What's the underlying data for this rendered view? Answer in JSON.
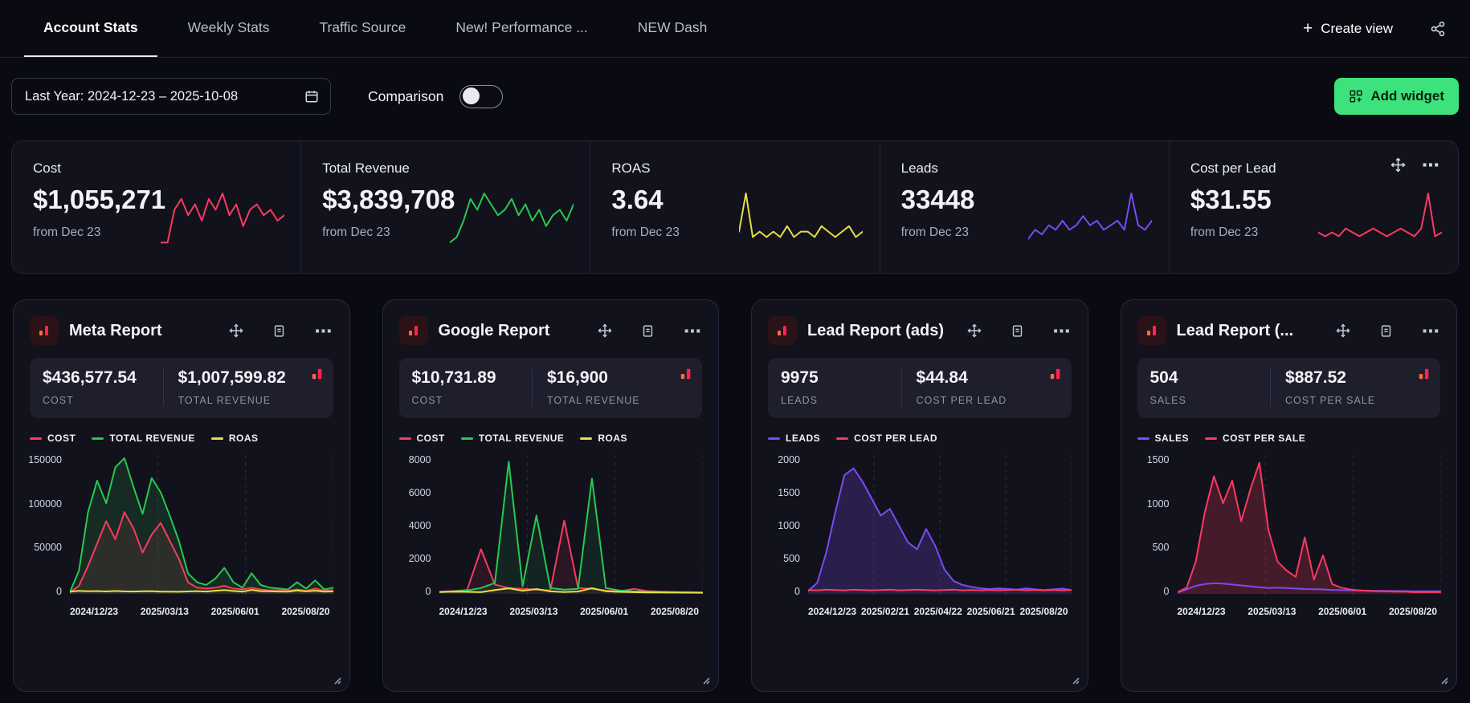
{
  "tabs": {
    "items": [
      {
        "label": "Account Stats",
        "active": true
      },
      {
        "label": "Weekly Stats",
        "active": false
      },
      {
        "label": "Traffic Source",
        "active": false
      },
      {
        "label": "New! Performance ...",
        "active": false
      },
      {
        "label": "NEW Dash",
        "active": false
      }
    ],
    "create_view_label": "Create view"
  },
  "icons": {
    "plus": "+",
    "ellipsis": "⋯"
  },
  "filters": {
    "date_range": "Last Year: 2024-12-23 – 2025-10-08",
    "comparison_label": "Comparison",
    "comparison_on": false,
    "add_widget_label": "Add widget",
    "add_widget_color": "#3ee27d"
  },
  "kpis": [
    {
      "label": "Cost",
      "value": "$1,055,271",
      "sub": "from Dec 23",
      "color": "#fb3a5e",
      "spark": [
        1,
        1,
        7,
        9,
        6,
        8,
        5,
        9,
        7,
        10,
        6,
        8,
        4,
        7,
        8,
        6,
        7,
        5,
        6
      ]
    },
    {
      "label": "Total Revenue",
      "value": "$3,839,708",
      "sub": "from Dec 23",
      "color": "#27c94f",
      "spark": [
        1,
        2,
        5,
        9,
        7,
        10,
        8,
        6,
        7,
        9,
        6,
        8,
        5,
        7,
        4,
        6,
        7,
        5,
        8
      ]
    },
    {
      "label": "ROAS",
      "value": "3.64",
      "sub": "from Dec 23",
      "color": "#e6df43",
      "spark": [
        3,
        10,
        2,
        3,
        2,
        3,
        2,
        4,
        2,
        3,
        3,
        2,
        4,
        3,
        2,
        3,
        4,
        2,
        3
      ]
    },
    {
      "label": "Leads",
      "value": "33448",
      "sub": "from Dec 23",
      "color": "#7a4bf5",
      "spark": [
        2,
        4,
        3,
        5,
        4,
        6,
        4,
        5,
        7,
        5,
        6,
        4,
        5,
        6,
        4,
        12,
        5,
        4,
        6
      ]
    },
    {
      "label": "Cost per Lead",
      "value": "$31.55",
      "sub": "from Dec 23",
      "color": "#fb3a5e",
      "spark": [
        4,
        3,
        4,
        3,
        5,
        4,
        3,
        4,
        5,
        4,
        3,
        4,
        5,
        4,
        3,
        5,
        14,
        3,
        4
      ]
    }
  ],
  "widgets": [
    {
      "title": "Meta Report",
      "stats": [
        {
          "value": "$436,577.54",
          "label": "COST"
        },
        {
          "value": "$1,007,599.82",
          "label": "TOTAL REVENUE"
        }
      ],
      "chart": {
        "type": "line",
        "y_ticks": [
          150000,
          100000,
          50000,
          0
        ],
        "y_max": 150000,
        "x_labels": [
          "2024/12/23",
          "2025/03/13",
          "2025/06/01",
          "2025/08/20"
        ],
        "series": [
          {
            "name": "COST",
            "color": "#fb3a5e",
            "fill": 0.12,
            "values": [
              500,
              8000,
              30000,
              55000,
              80000,
              60000,
              90000,
              72000,
              45000,
              65000,
              78000,
              58000,
              38000,
              12000,
              6000,
              5000,
              6000,
              8000,
              5000,
              4000,
              6000,
              4000,
              3000,
              3000,
              2500,
              4000,
              2500,
              5000,
              2500,
              3000
            ]
          },
          {
            "name": "TOTAL REVENUE",
            "color": "#27c94f",
            "fill": 0.14,
            "values": [
              1000,
              25000,
              90000,
              125000,
              100000,
              140000,
              150000,
              118000,
              88000,
              128000,
              112000,
              86000,
              58000,
              22000,
              12000,
              9000,
              16000,
              28000,
              12000,
              6000,
              22000,
              9000,
              6000,
              5000,
              4000,
              12000,
              5000,
              14000,
              4000,
              6000
            ]
          },
          {
            "name": "ROAS",
            "color": "#e6df43",
            "fill": 0,
            "values": [
              1500,
              2500,
              2000,
              2200,
              1800,
              2300,
              1900,
              1700,
              2000,
              2100,
              1600,
              1500,
              1400,
              1800,
              2100,
              1700,
              2600,
              3400,
              2300,
              1500,
              3600,
              2100,
              1900,
              1700,
              1600,
              2900,
              1900,
              2700,
              1600,
              1900
            ]
          }
        ]
      }
    },
    {
      "title": "Google Report",
      "stats": [
        {
          "value": "$10,731.89",
          "label": "COST"
        },
        {
          "value": "$16,900",
          "label": "TOTAL REVENUE"
        }
      ],
      "chart": {
        "type": "line",
        "y_ticks": [
          8000,
          6000,
          4000,
          2000,
          0
        ],
        "y_max": 8000,
        "x_labels": [
          "2024/12/23",
          "2025/03/13",
          "2025/06/01",
          "2025/08/20"
        ],
        "series": [
          {
            "name": "COST",
            "color": "#fb3a5e",
            "fill": 0.1,
            "values": [
              80,
              120,
              180,
              2600,
              500,
              300,
              250,
              200,
              150,
              4300,
              300,
              250,
              150,
              100,
              250,
              120,
              80,
              60,
              50,
              40
            ]
          },
          {
            "name": "TOTAL REVENUE",
            "color": "#27c94f",
            "fill": 0.1,
            "values": [
              50,
              100,
              150,
              300,
              600,
              7800,
              400,
              4600,
              300,
              200,
              250,
              6800,
              300,
              150,
              100,
              80,
              60,
              50,
              40,
              30
            ]
          },
          {
            "name": "ROAS",
            "color": "#e6df43",
            "fill": 0,
            "values": [
              60,
              80,
              70,
              50,
              180,
              280,
              140,
              240,
              100,
              60,
              90,
              290,
              110,
              70,
              50,
              40,
              35,
              30,
              25,
              20
            ]
          }
        ]
      }
    },
    {
      "title": "Lead Report (ads)",
      "stats": [
        {
          "value": "9975",
          "label": "LEADS"
        },
        {
          "value": "$44.84",
          "label": "COST PER LEAD"
        }
      ],
      "chart": {
        "type": "line",
        "y_ticks": [
          2000,
          1500,
          1000,
          500,
          0
        ],
        "y_max": 2000,
        "x_labels": [
          "2024/12/23",
          "2025/02/21",
          "2025/04/22",
          "2025/06/21",
          "2025/08/20"
        ],
        "series": [
          {
            "name": "LEADS",
            "color": "#7a4bf5",
            "fill": 0.22,
            "values": [
              30,
              150,
              600,
              1200,
              1750,
              1850,
              1650,
              1400,
              1150,
              1250,
              1000,
              750,
              650,
              950,
              700,
              350,
              180,
              120,
              90,
              70,
              60,
              70,
              60,
              50,
              70,
              55,
              45,
              55,
              65,
              45
            ]
          },
          {
            "name": "COST PER LEAD",
            "color": "#fb3a5e",
            "fill": 0,
            "values": [
              45,
              40,
              50,
              45,
              40,
              50,
              45,
              40,
              45,
              50,
              40,
              45,
              50,
              45,
              40,
              45,
              50,
              40,
              45,
              40,
              45,
              40,
              45,
              50,
              40,
              45,
              40,
              45,
              40,
              45
            ]
          }
        ]
      }
    },
    {
      "title": "Lead Report (...",
      "stats": [
        {
          "value": "504",
          "label": "SALES"
        },
        {
          "value": "$887.52",
          "label": "COST PER SALE"
        }
      ],
      "chart": {
        "type": "line",
        "y_ticks": [
          1500,
          1000,
          500,
          0
        ],
        "y_max": 1500,
        "x_labels": [
          "2024/12/23",
          "2025/03/13",
          "2025/06/01",
          "2025/08/20"
        ],
        "series": [
          {
            "name": "SALES",
            "color": "#7a4bf5",
            "fill": 0,
            "values": [
              5,
              40,
              80,
              100,
              110,
              105,
              95,
              85,
              75,
              65,
              55,
              60,
              55,
              50,
              45,
              42,
              40,
              35,
              32,
              30,
              28,
              26,
              25,
              24,
              22,
              22,
              20,
              20,
              20,
              20
            ]
          },
          {
            "name": "COST PER SALE",
            "color": "#fb3a5e",
            "fill": 0.22,
            "values": [
              10,
              60,
              350,
              900,
              1300,
              1000,
              1250,
              800,
              1150,
              1450,
              700,
              350,
              250,
              180,
              620,
              150,
              420,
              100,
              60,
              40,
              30,
              25,
              20,
              20,
              15,
              15,
              10,
              10,
              10,
              10
            ]
          }
        ]
      }
    }
  ]
}
